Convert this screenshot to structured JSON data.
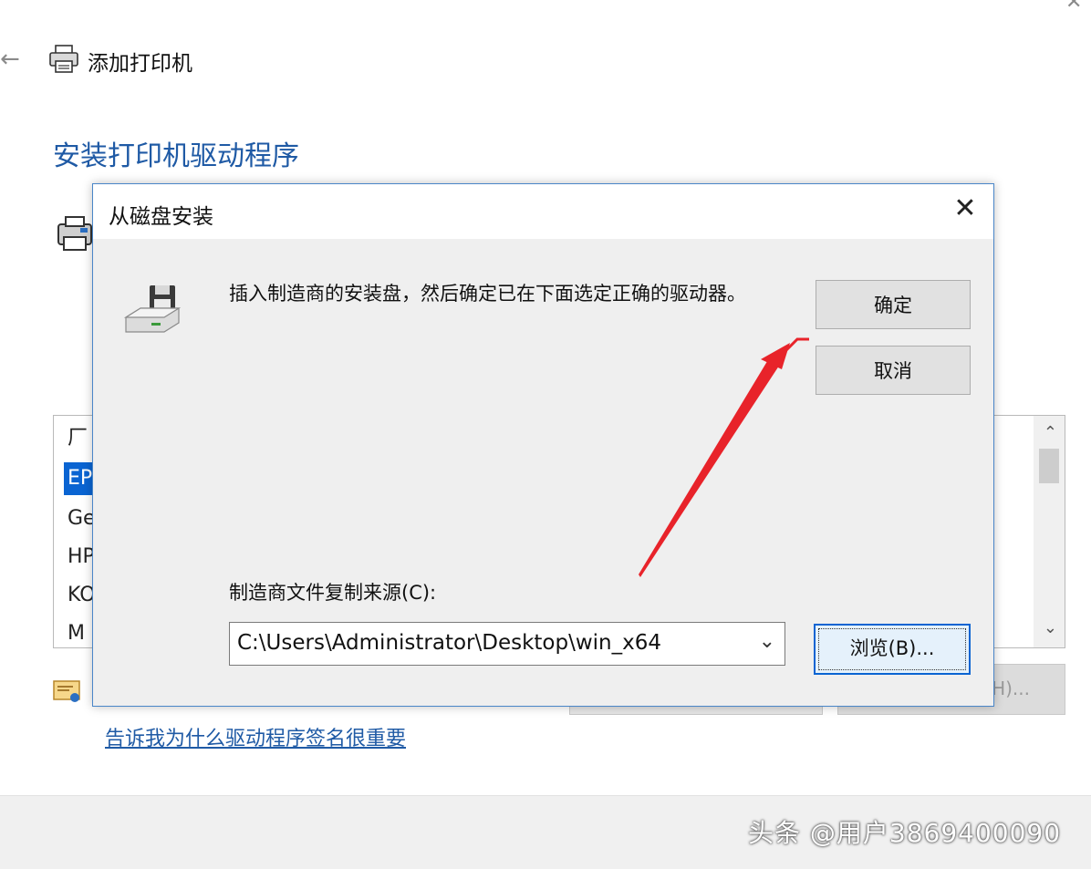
{
  "wizard": {
    "title": "添加打印机",
    "heading": "安装打印机驱动程序",
    "manufacturers": {
      "header": "厂",
      "items": [
        "EP",
        "Ge",
        "HP",
        "KO",
        "M"
      ]
    },
    "partial_button_text": "H)...",
    "signing_link": "告诉我为什么驱动程序签名很重要"
  },
  "dialog": {
    "title": "从磁盘安装",
    "message": "插入制造商的安装盘，然后确定已在下面选定正确的驱动器。",
    "ok_label": "确定",
    "cancel_label": "取消",
    "source_label": "制造商文件复制来源(C):",
    "source_value": "C:\\Users\\Administrator\\Desktop\\win_x64",
    "browse_label": "浏览(B)..."
  },
  "watermark": "头条 @用户3869400090",
  "colors": {
    "heading_blue": "#1f5aa5",
    "selection_blue": "#0a64d2",
    "annotation_red": "#e8232a"
  }
}
